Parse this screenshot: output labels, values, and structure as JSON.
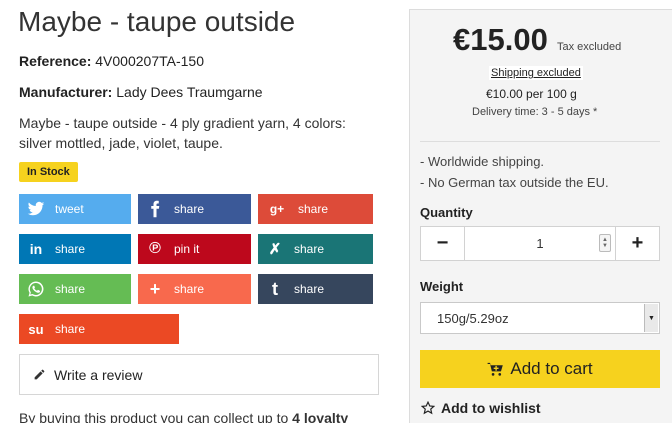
{
  "product": {
    "title": "Maybe - taupe outside",
    "reference_label": "Reference:",
    "reference_value": "4V000207TA-150",
    "manufacturer_label": "Manufacturer:",
    "manufacturer_value": "Lady Dees Traumgarne",
    "description": "Maybe - taupe outside - 4 ply gradient yarn, 4 colors: silver mottled, jade, violet, taupe.",
    "stock_badge": "In Stock"
  },
  "share": {
    "buttons": [
      {
        "name": "twitter",
        "label": "tweet",
        "color": "#55acee"
      },
      {
        "name": "facebook",
        "label": "share",
        "color": "#3b5998"
      },
      {
        "name": "googleplus",
        "label": "share",
        "color": "#dd4b39"
      },
      {
        "name": "linkedin",
        "label": "share",
        "color": "#0077b5"
      },
      {
        "name": "pinterest",
        "label": "pin it",
        "color": "#bd081c"
      },
      {
        "name": "xing",
        "label": "share",
        "color": "#1a7576"
      },
      {
        "name": "whatsapp",
        "label": "share",
        "color": "#65bc54"
      },
      {
        "name": "addthis",
        "label": "share",
        "color": "#f8694d"
      },
      {
        "name": "tumblr",
        "label": "share",
        "color": "#36465d"
      },
      {
        "name": "stumbleupon",
        "label": "share",
        "color": "#eb4924"
      }
    ]
  },
  "review": {
    "label": "Write a review"
  },
  "loyalty": {
    "text_prefix": "By buying this product you can collect up to ",
    "points": "4 loyalty"
  },
  "buybox": {
    "price": "€15.00",
    "tax_label": "Tax excluded",
    "shipping_label": "Shipping excluded",
    "unit_price": "€10.00 per 100 g",
    "delivery": "Delivery time: 3 - 5 days *",
    "notes": [
      "- Worldwide shipping.",
      "- No German tax outside the EU."
    ],
    "quantity_label": "Quantity",
    "quantity_value": "1",
    "minus": "−",
    "plus": "+",
    "weight_label": "Weight",
    "weight_selected": "150g/5.29oz",
    "add_to_cart": "Add to cart",
    "add_to_wishlist": "Add to wishlist",
    "accent_color": "#f6d21e"
  }
}
